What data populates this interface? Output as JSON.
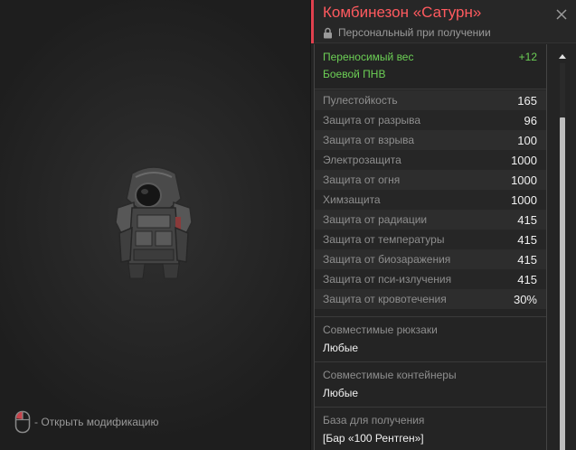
{
  "item": {
    "title": "Комбинезон «Сатурн»",
    "binding": "Персональный при получении",
    "icon": "suit-icon"
  },
  "bonuses": [
    {
      "label": "Переносимый вес",
      "value": "+12"
    },
    {
      "label": "Боевой ПНВ",
      "value": ""
    }
  ],
  "stats": [
    {
      "label": "Пулестойкость",
      "value": "165"
    },
    {
      "label": "Защита от разрыва",
      "value": "96"
    },
    {
      "label": "Защита от взрыва",
      "value": "100"
    },
    {
      "label": "Электрозащита",
      "value": "1000"
    },
    {
      "label": "Защита от огня",
      "value": "1000"
    },
    {
      "label": "Химзащита",
      "value": "1000"
    },
    {
      "label": "Защита от радиации",
      "value": "415"
    },
    {
      "label": "Защита от температуры",
      "value": "415"
    },
    {
      "label": "Защита от биозаражения",
      "value": "415"
    },
    {
      "label": "Защита от пси-излучения",
      "value": "415"
    },
    {
      "label": "Защита от кровотечения",
      "value": "30%"
    }
  ],
  "compat": {
    "backpacks_label": "Совместимые рюкзаки",
    "backpacks_value": "Любые",
    "containers_label": "Совместимые контейнеры",
    "containers_value": "Любые"
  },
  "source": {
    "label": "База для получения",
    "value": "[Бар «100 Рентген»]"
  },
  "hint": {
    "text": "- Открыть модификацию",
    "icon": "mouse-icon"
  },
  "colors": {
    "title": "#ff5a5f",
    "accent": "#e0404e",
    "bonus": "#6ccf55",
    "background": "#1c1c1c",
    "panel": "#242424"
  }
}
